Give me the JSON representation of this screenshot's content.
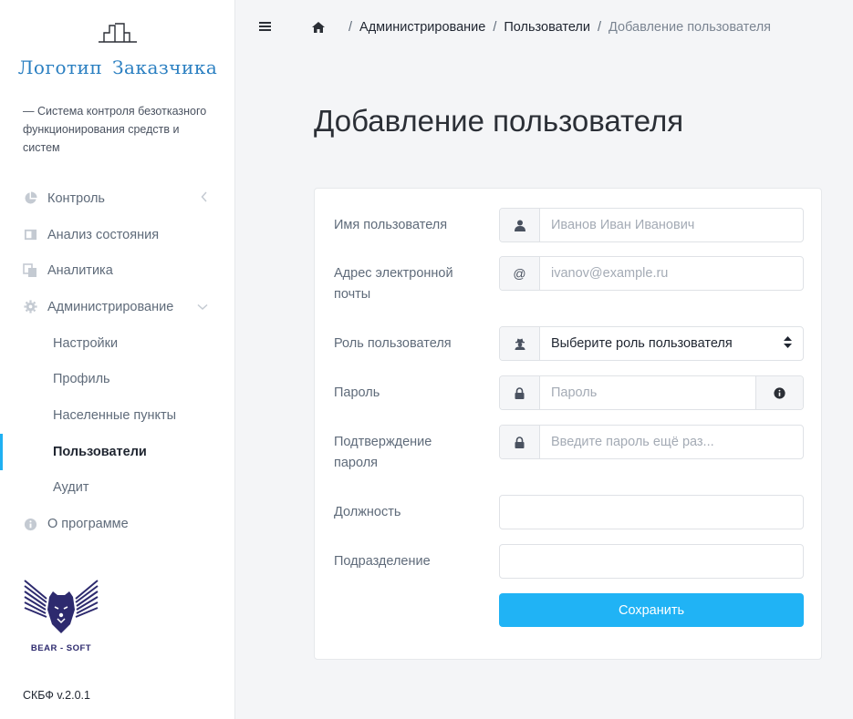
{
  "sidebar": {
    "logo_text": "Логотип Заказчика",
    "tagline": "— Система контроля безотказного функционирования средств и систем",
    "items": [
      {
        "label": "Контроль",
        "icon": "pie-chart-icon"
      },
      {
        "label": "Анализ состояния",
        "icon": "panel-icon"
      },
      {
        "label": "Аналитика",
        "icon": "copy-icon"
      },
      {
        "label": "Администрирование",
        "icon": "gear-icon"
      },
      {
        "label": "Настройки"
      },
      {
        "label": "Профиль"
      },
      {
        "label": "Населенные пункты"
      },
      {
        "label": "Пользователи"
      },
      {
        "label": "Аудит"
      },
      {
        "label": "О программе",
        "icon": "info-icon"
      }
    ],
    "brand_text": "BEAR - SOFT",
    "version": "СКБФ v.2.0.1"
  },
  "breadcrumb": {
    "items": [
      "Администрирование",
      "Пользователи"
    ],
    "current": "Добавление пользователя"
  },
  "page": {
    "title": "Добавление пользователя"
  },
  "form": {
    "username": {
      "label": "Имя пользователя",
      "placeholder": "Иванов Иван Иванович",
      "value": ""
    },
    "email": {
      "label": "Адрес электронной почты",
      "placeholder": "ivanov@example.ru",
      "value": "",
      "addon": "@"
    },
    "role": {
      "label": "Роль пользователя",
      "selected": "Выберите роль пользователя"
    },
    "password": {
      "label": "Пароль",
      "placeholder": "Пароль",
      "value": ""
    },
    "password_confirm": {
      "label": "Подтверждение пароля",
      "placeholder": "Введите пароль ещё раз...",
      "value": ""
    },
    "position": {
      "label": "Должность",
      "value": ""
    },
    "department": {
      "label": "Подразделение",
      "value": ""
    },
    "save_label": "Сохранить"
  },
  "colors": {
    "accent": "#20b3f5",
    "logo": "#2a7fc1",
    "active_indicator": "#1fb0f2"
  }
}
